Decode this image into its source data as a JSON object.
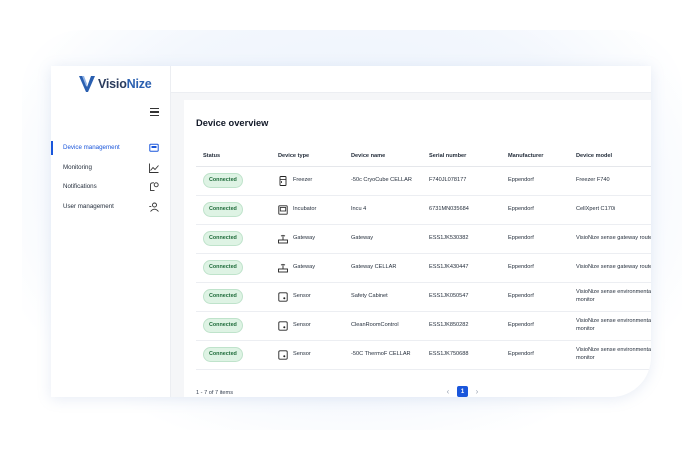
{
  "brand": {
    "name_part1": "Visio",
    "name_part2": "Nize"
  },
  "sidebar": {
    "items": [
      {
        "label": "Device management",
        "icon": "device-icon",
        "active": true
      },
      {
        "label": "Monitoring",
        "icon": "chart-icon",
        "active": false
      },
      {
        "label": "Notifications",
        "icon": "bell-icon",
        "active": false
      },
      {
        "label": "User management",
        "icon": "user-icon",
        "active": false
      }
    ]
  },
  "main": {
    "title": "Device overview",
    "columns": [
      "Status",
      "Device type",
      "Device name",
      "Serial number",
      "Manufacturer",
      "Device model"
    ],
    "rows": [
      {
        "status": "Connected",
        "type": "Freezer",
        "type_icon": "freezer-icon",
        "name": "-50c CryoCube CELLAR",
        "serial": "F740JL078177",
        "manufacturer": "Eppendorf",
        "model": "Freezer F740"
      },
      {
        "status": "Connected",
        "type": "Incubator",
        "type_icon": "incubator-icon",
        "name": "Incu 4",
        "serial": "6731MN035684",
        "manufacturer": "Eppendorf",
        "model": "CellXpert C170i"
      },
      {
        "status": "Connected",
        "type": "Gateway",
        "type_icon": "gateway-icon",
        "name": "Gateway",
        "serial": "ESS1JK530382",
        "manufacturer": "Eppendorf",
        "model": "VisioNize sense gateway router"
      },
      {
        "status": "Connected",
        "type": "Gateway",
        "type_icon": "gateway-icon",
        "name": "Gateway CELLAR",
        "serial": "ESS1JK430447",
        "manufacturer": "Eppendorf",
        "model": "VisioNize sense gateway router"
      },
      {
        "status": "Connected",
        "type": "Sensor",
        "type_icon": "sensor-icon",
        "name": "Safety Cabinet",
        "serial": "ESS1JK050547",
        "manufacturer": "Eppendorf",
        "model": "VisioNize sense environmental monitor"
      },
      {
        "status": "Connected",
        "type": "Sensor",
        "type_icon": "sensor-icon",
        "name": "CleanRoomControl",
        "serial": "ESS1JK850282",
        "manufacturer": "Eppendorf",
        "model": "VisioNize sense environmental monitor"
      },
      {
        "status": "Connected",
        "type": "Sensor",
        "type_icon": "sensor-icon",
        "name": "-50C ThermoF CELLAR",
        "serial": "ESS1JK750688",
        "manufacturer": "Eppendorf",
        "model": "VisioNize sense environmental monitor"
      }
    ],
    "footer": {
      "count_text": "1 - 7 of 7 items",
      "current_page": "1",
      "prev": "‹",
      "next": "›"
    }
  },
  "colors": {
    "accent": "#1a56db",
    "badge_bg": "#def3e4",
    "badge_text": "#1e6b3a"
  }
}
